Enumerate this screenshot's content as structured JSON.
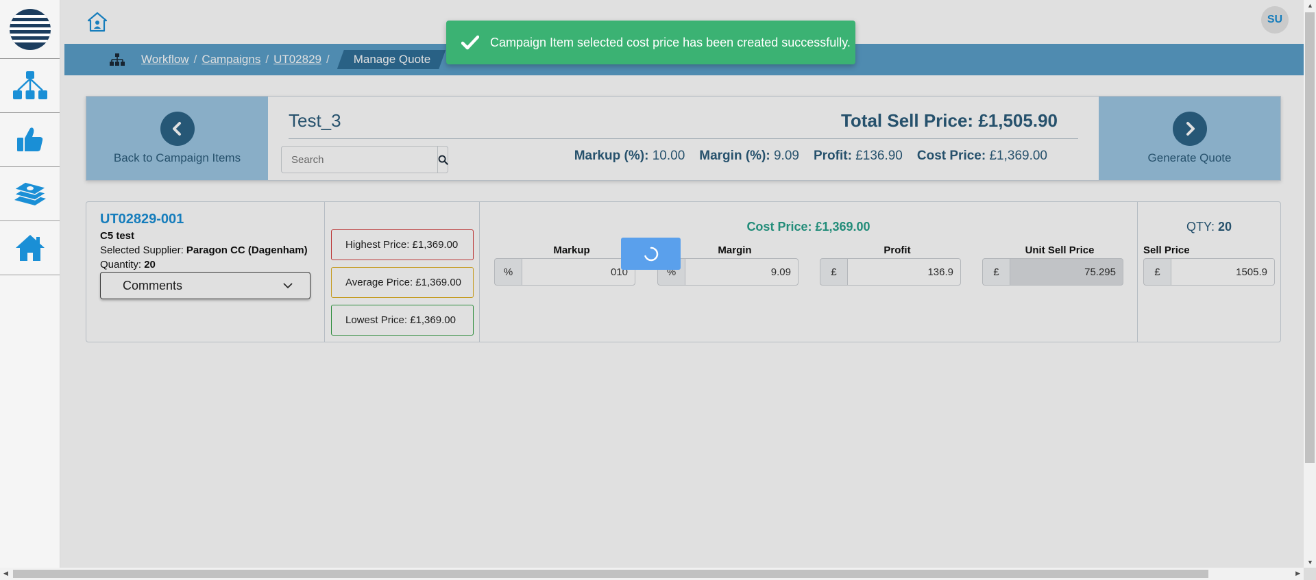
{
  "topbar": {
    "avatar_initials": "SU"
  },
  "breadcrumb": {
    "items": [
      "Workflow",
      "Campaigns",
      "UT02829"
    ],
    "current": "Manage Quote",
    "separator": "/"
  },
  "toast": {
    "message": "Campaign Item selected cost price has been created successfully."
  },
  "quote": {
    "title": "Test_3",
    "total_sell_label": "Total Sell Price:",
    "total_sell_value": "£1,505.90",
    "back_label": "Back to Campaign Items",
    "generate_label": "Generate Quote",
    "search_placeholder": "Search",
    "summary": {
      "markup_label": "Markup (%):",
      "markup_value": "10.00",
      "margin_label": "Margin (%):",
      "margin_value": "9.09",
      "profit_label": "Profit:",
      "profit_value": "£136.90",
      "cost_label": "Cost Price:",
      "cost_value": "£1,369.00"
    }
  },
  "item": {
    "code": "UT02829-001",
    "name": "C5 test",
    "supplier_label": "Selected Supplier:",
    "supplier": "Paragon CC (Dagenham)",
    "quantity_label": "Quantity:",
    "quantity": "20",
    "comments_label": "Comments",
    "highest": "Highest Price: £1,369.00",
    "average": "Average Price: £1,369.00",
    "lowest": "Lowest Price: £1,369.00",
    "cost_price": "Cost Price: £1,369.00",
    "fields": {
      "markup": {
        "label": "Markup",
        "addon": "%",
        "value": "010"
      },
      "margin": {
        "label": "Margin",
        "addon": "%",
        "value": "9.09"
      },
      "profit": {
        "label": "Profit",
        "addon": "£",
        "value": "136.9"
      },
      "unit_sell": {
        "label": "Unit Sell Price",
        "addon": "£",
        "value": "75.295"
      }
    },
    "qty_label": "QTY:",
    "qty_value": "20",
    "sell_price_label": "Sell Price",
    "sell_price_addon": "£",
    "sell_price_value": "1505.9"
  },
  "colors": {
    "accent": "#1a8fd6",
    "breadcrumb_bar": "#5b9fc9",
    "nav_panel": "#9dc6e3",
    "toast": "#3bb273",
    "cost_text": "#27a08a"
  }
}
